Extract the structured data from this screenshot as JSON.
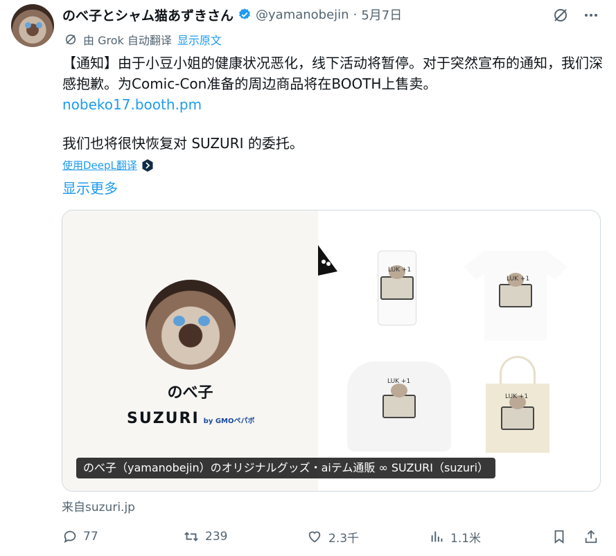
{
  "post": {
    "display_name": "のべ子とシャム猫あずきさん",
    "handle": "@yamanobejin",
    "separator": "·",
    "date": "5月7日"
  },
  "translation": {
    "prefix": "由 Grok 自动翻译",
    "show_original": "显示原文"
  },
  "body": {
    "paragraph1": "【通知】由于小豆小姐的健康状况恶化，线下活动将暂停。对于突然宣布的通知，我们深感抱歉。为Comic-Con准备的周边商品将在BOOTH上售卖。",
    "link": "nobeko17.booth.pm",
    "paragraph2": "我们也将很快恢复对 SUZURI 的委托。",
    "deepl": "使用DeepL翻译",
    "show_more": "显示更多"
  },
  "card": {
    "name": "のべ子",
    "brand": "SUZURI",
    "brand_sub": "by GMOペパボ",
    "product_label": "LUK +1",
    "caption": "のべ子（yamanobejin）のオリジナルグッズ・aiテム通販 ∞ SUZURI（suzuri）",
    "source": "来自suzuri.jp"
  },
  "actions": {
    "replies": "77",
    "reposts": "239",
    "likes": "2.3千",
    "views": "1.1米"
  },
  "icons": {
    "verified": "verified-badge-icon",
    "grok": "grok-icon",
    "more": "more-icon",
    "translate": "translate-icon",
    "deepl": "deepl-icon",
    "reply": "reply-icon",
    "repost": "repost-icon",
    "like": "heart-icon",
    "views": "views-icon",
    "bookmark": "bookmark-icon",
    "share": "share-icon"
  },
  "colors": {
    "accent": "#1d9bf0",
    "muted": "#536471",
    "text": "#0f1419"
  }
}
